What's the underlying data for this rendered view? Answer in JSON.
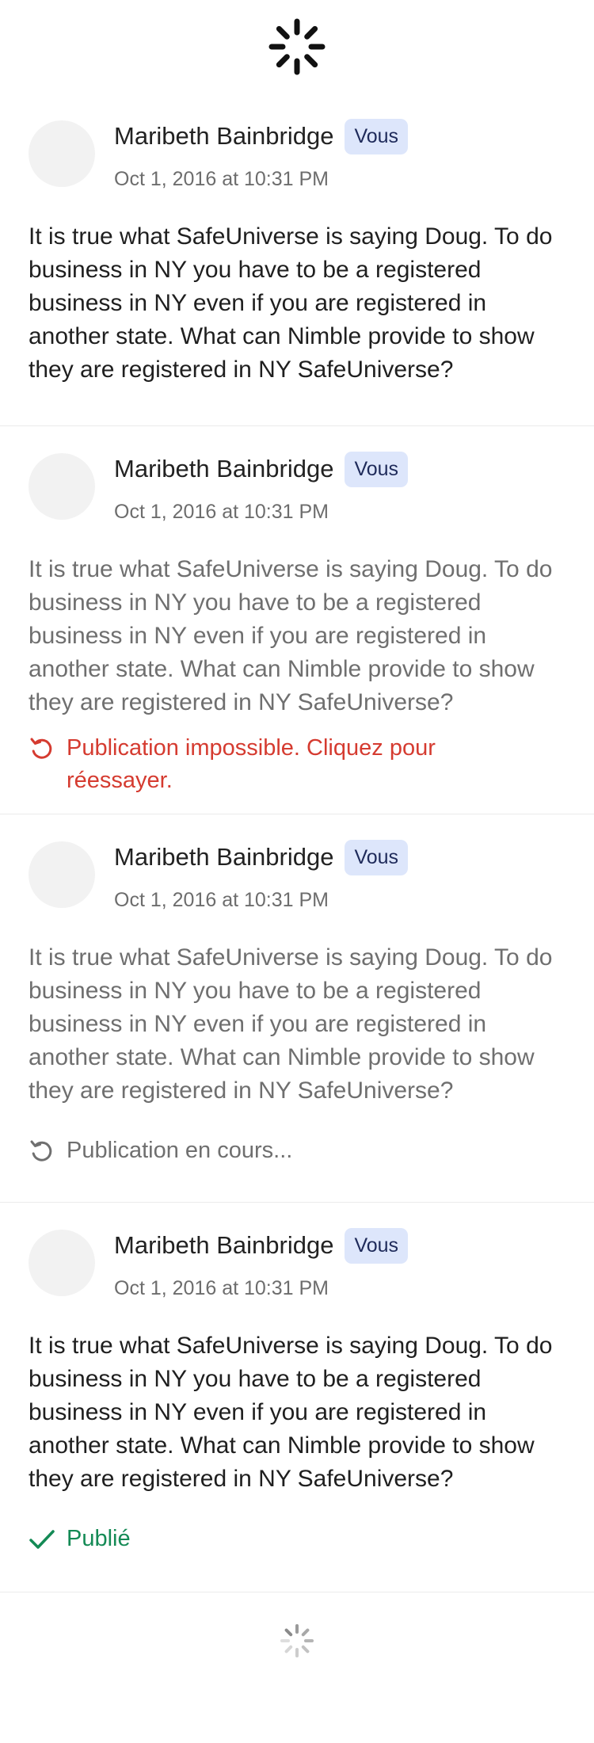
{
  "comments": [
    {
      "author": "Maribeth Bainbridge",
      "badge": "Vous",
      "timestamp": "Oct 1, 2016 at 10:31 PM",
      "text": "It is true what SafeUniverse is saying Doug. To do business in NY you have to be a registered business in NY even if you are registered in another state. What can Nimble provide to show they are registered in NY SafeUniverse?"
    },
    {
      "author": "Maribeth Bainbridge",
      "badge": "Vous",
      "timestamp": "Oct 1, 2016 at 10:31 PM",
      "text": "It is true what SafeUniverse is saying Doug. To do business in NY you have to be a registered business in NY even if you are registered in another state. What can Nimble provide to show they are registered in NY SafeUniverse?",
      "status": "Publication impossible. Cliquez pour réessayer.",
      "status_icon": "retry-icon"
    },
    {
      "author": "Maribeth Bainbridge",
      "badge": "Vous",
      "timestamp": "Oct 1, 2016 at 10:31 PM",
      "text": "It is true what SafeUniverse is saying Doug. To do business in NY you have to be a registered business in NY even if you are registered in another state. What can Nimble provide to show they are registered in NY SafeUniverse?",
      "status": "Publication en cours...",
      "status_icon": "sync-icon"
    },
    {
      "author": "Maribeth Bainbridge",
      "badge": "Vous",
      "timestamp": "Oct 1, 2016 at 10:31 PM",
      "text": "It is true what SafeUniverse is saying Doug. To do business in NY you have to be a registered business in NY even if you are registered in another state. What can Nimble provide to show they are registered in NY SafeUniverse?",
      "status": "Publié",
      "status_icon": "checkmark-icon"
    }
  ],
  "icons": {
    "top": "spinner-icon",
    "bottom": "spinner-icon"
  },
  "colors": {
    "error": "#d53b30",
    "success": "#148a55",
    "muted": "#6f6f6f",
    "badge_bg": "#dde6fb"
  }
}
